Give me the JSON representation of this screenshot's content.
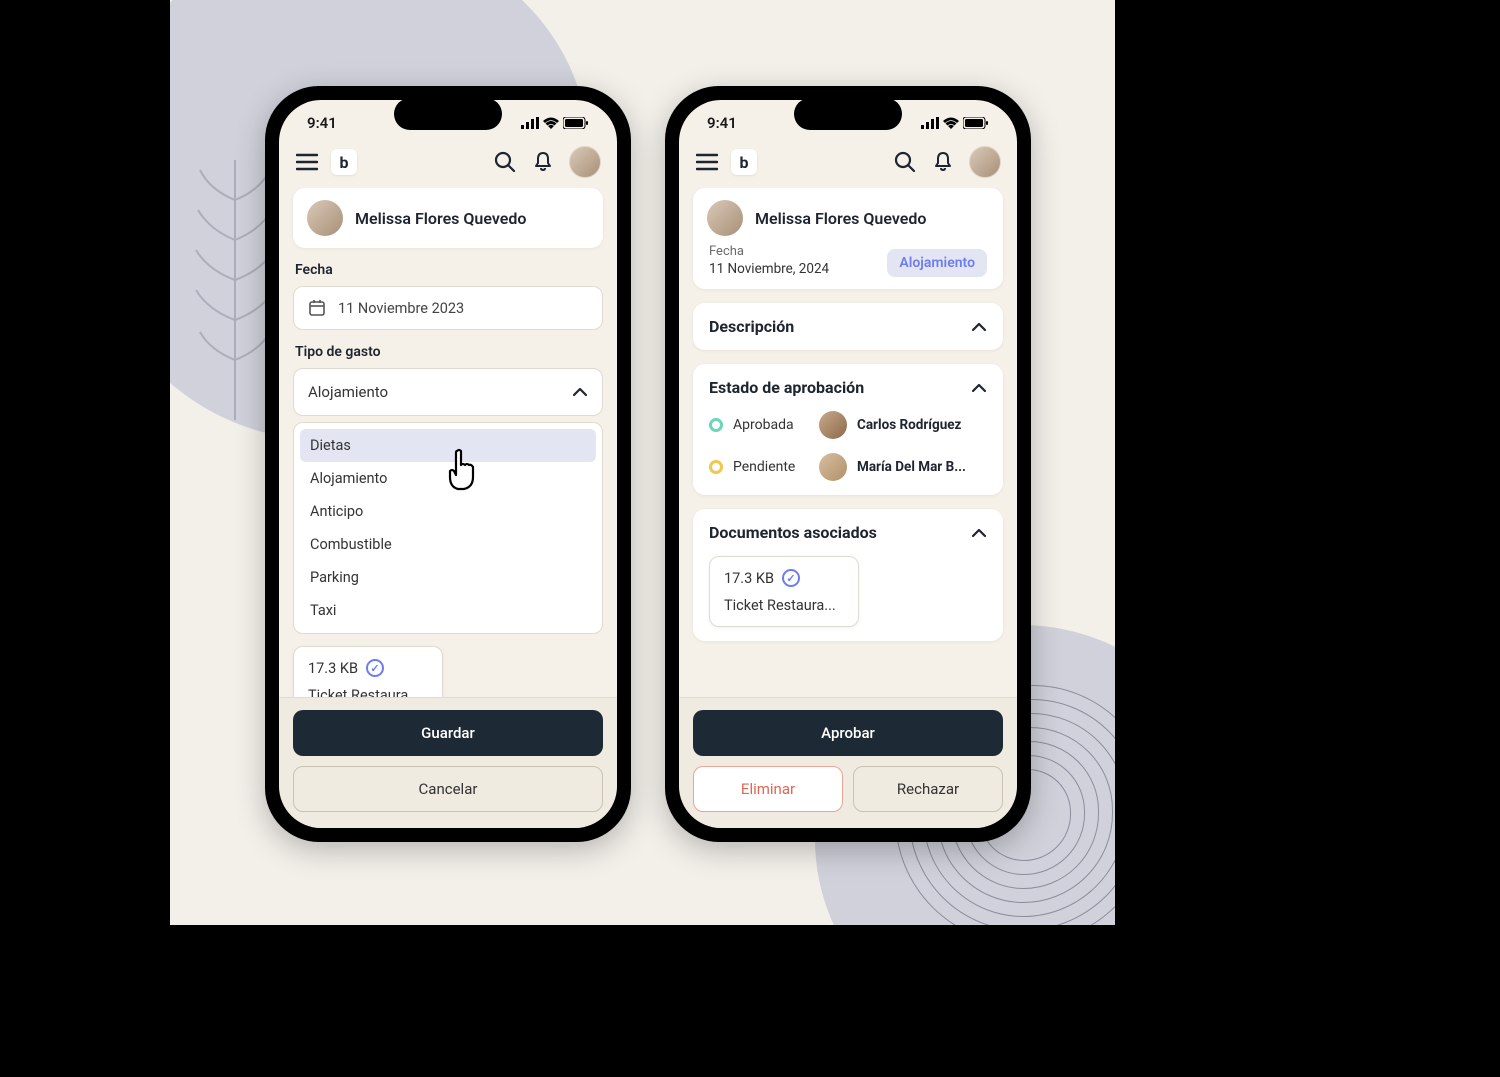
{
  "statusbar": {
    "time": "9:41"
  },
  "user": {
    "name": "Melissa Flores Quevedo"
  },
  "left": {
    "date_label": "Fecha",
    "date_value": "11 Noviembre 2023",
    "expense_type_label": "Tipo de gasto",
    "expense_type_value": "Alojamiento",
    "options": [
      "Dietas",
      "Alojamiento",
      "Anticipo",
      "Combustible",
      "Parking",
      "Taxi"
    ],
    "highlighted_option_index": 0,
    "doc": {
      "size": "17.3 KB",
      "name": "Ticket Restaura..."
    },
    "save_label": "Guardar",
    "cancel_label": "Cancelar"
  },
  "right": {
    "date_label": "Fecha",
    "date_value": "11 Noviembre, 2024",
    "tag": "Alojamiento",
    "description_title": "Descripción",
    "approval_title": "Estado de aprobación",
    "approvals": [
      {
        "status": "Aprobada",
        "approver": "Carlos Rodríguez",
        "color": "green"
      },
      {
        "status": "Pendiente",
        "approver": "María Del Mar B...",
        "color": "yellow"
      }
    ],
    "documents_title": "Documentos asociados",
    "doc": {
      "size": "17.3 KB",
      "name": "Ticket Restaura..."
    },
    "approve_label": "Aprobar",
    "delete_label": "Eliminar",
    "reject_label": "Rechazar"
  },
  "app": {
    "brand_letter": "b"
  }
}
